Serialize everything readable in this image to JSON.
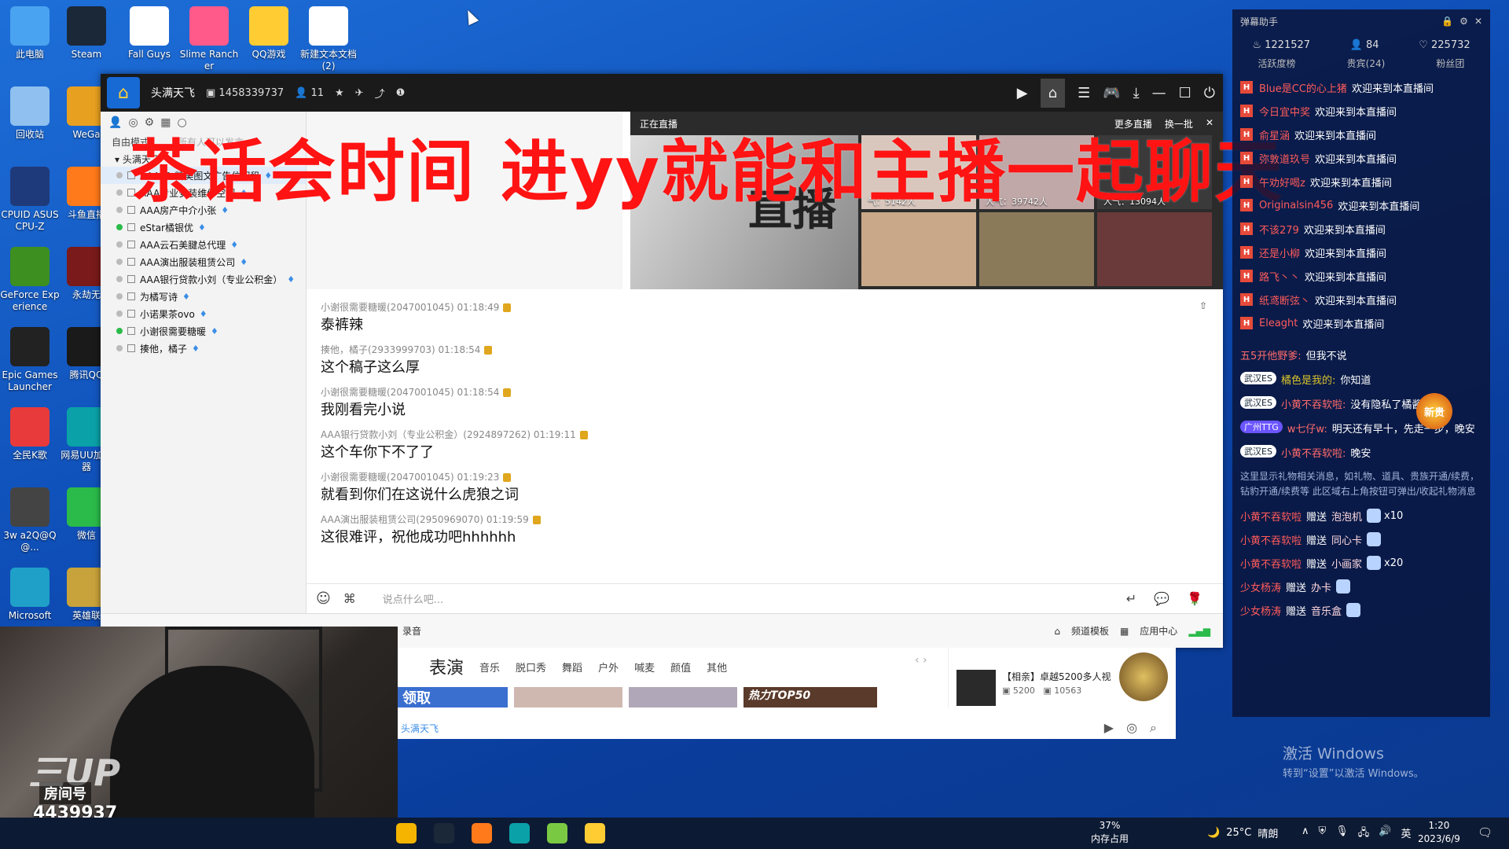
{
  "desktop": {
    "col1": [
      {
        "label": "此电脑",
        "icon": "computer-icon",
        "color": "#4aa3f0"
      },
      {
        "label": "回收站",
        "icon": "recycle-bin-icon",
        "color": "#8fc0ef"
      },
      {
        "label": "CPUID ASUS CPU-Z",
        "icon": "cpuz-icon",
        "color": "#1f3a7a"
      },
      {
        "label": "GeForce Experience",
        "icon": "geforce-icon",
        "color": "#3d8f1f"
      },
      {
        "label": "Epic Games Launcher",
        "icon": "epic-games-icon",
        "color": "#222222"
      },
      {
        "label": "全民K歌",
        "icon": "quanmin-ksong-icon",
        "color": "#e83a3a"
      },
      {
        "label": "3w a2Q@Q@...",
        "icon": "file-icon",
        "color": "#444444"
      },
      {
        "label": "Microsoft",
        "icon": "edge-icon",
        "color": "#1fa0c8"
      }
    ],
    "col2": [
      {
        "label": "Steam",
        "icon": "steam-icon",
        "color": "#1b2838"
      },
      {
        "label": "WeGa",
        "icon": "wegame-icon",
        "color": "#e8a020"
      },
      {
        "label": "斗鱼直播",
        "icon": "douyu-icon",
        "color": "#ff7a1a"
      },
      {
        "label": "永劫无",
        "icon": "naraka-icon",
        "color": "#7a1a1a"
      },
      {
        "label": "腾讯QQ",
        "icon": "qq-icon",
        "color": "#1a1a1a"
      },
      {
        "label": "网易UU加速器",
        "icon": "uu-icon",
        "color": "#0aa2a8"
      },
      {
        "label": "微信",
        "icon": "wechat-icon",
        "color": "#2bbb4a"
      },
      {
        "label": "英雄联",
        "icon": "lol-icon",
        "color": "#c8a23a"
      }
    ],
    "top": [
      {
        "label": "Fall Guys",
        "icon": "fall-guys-icon",
        "color": "#ffffff"
      },
      {
        "label": "Slime Rancher",
        "icon": "slime-rancher-icon",
        "color": "#ff5a8a"
      },
      {
        "label": "QQ游戏",
        "icon": "qq-game-icon",
        "color": "#ffcc33"
      },
      {
        "label": "新建文本文档 (2)",
        "icon": "text-doc-icon",
        "color": "#ffffff"
      }
    ]
  },
  "yy": {
    "title": "头满天飞",
    "channel_id": "1458339737",
    "online": "11",
    "overlay": "茶话会时间 进yy就能和主播一起聊天",
    "left": {
      "mode": "自由模式",
      "hint": "所有人可以发言",
      "root": "头满天飞",
      "items": [
        {
          "name": "AAA01 精美图文广告位招租",
          "on": false,
          "sel": true
        },
        {
          "name": "AAA专业安装维修空调",
          "on": false
        },
        {
          "name": "AAA房产中介小张",
          "on": false
        },
        {
          "name": "eStar橘银优",
          "on": true
        },
        {
          "name": "AAA云石美腱总代理",
          "on": false
        },
        {
          "name": "AAA演出服装租赁公司",
          "on": false
        },
        {
          "name": "AAA银行贷款小刘（专业公积金）",
          "on": false
        },
        {
          "name": "为橘写诗",
          "on": false
        },
        {
          "name": "小诺果茶ovo",
          "on": false
        },
        {
          "name": "小谢很需要糖暖",
          "on": true
        },
        {
          "name": "揍他，橘子",
          "on": false
        }
      ]
    },
    "rec": {
      "head": "正在直播",
      "more": "更多直播",
      "change": "换一批",
      "banner_text": "直播",
      "thumbs": [
        {
          "count": "气：5142人"
        },
        {
          "count": "人气：39742人"
        },
        {
          "count": "人气：13094人"
        },
        {
          "count": ""
        },
        {
          "count": ""
        },
        {
          "count": ""
        }
      ]
    },
    "messages": [
      {
        "user": "小谢很需要糖暖(2047001045)",
        "time": "01:18:49",
        "text": "泰裤辣"
      },
      {
        "user": "揍他，橘子(2933999703)",
        "time": "01:18:54",
        "text": "这个稿子这么厚"
      },
      {
        "user": "小谢很需要糖暖(2047001045)",
        "time": "01:18:54",
        "text": "我刚看完小说"
      },
      {
        "user": "AAA银行贷款小刘（专业公积金）(2924897262)",
        "time": "01:19:11",
        "text": "这个车你下不了了"
      },
      {
        "user": "小谢很需要糖暖(2047001045)",
        "time": "01:19:23",
        "text": "就看到你们在这说什么虎狼之词"
      },
      {
        "user": "AAA演出服装租赁公司(2950969070)",
        "time": "01:19:59",
        "text": "这很难评，祝他成功吧hhhhhh"
      }
    ],
    "input_placeholder": "说点什么吧...",
    "bottom": {
      "record": "录音",
      "template": "频道模板",
      "app_center": "应用中心"
    }
  },
  "sub": {
    "tabs": [
      "表演",
      "音乐",
      "脱口秀",
      "舞蹈",
      "户外",
      "喊麦",
      "颜值",
      "其他"
    ],
    "hot": "热力TOP50",
    "claim": "领取",
    "right_title": "【相亲】卓越5200多人视",
    "right_n1": "5200",
    "right_n2": "10563",
    "bottom_link": "头满天飞"
  },
  "camera": {
    "logo": "三UP",
    "room_label": "房间号",
    "room_no": "4439937"
  },
  "danmaku": {
    "title": "弹幕助手",
    "stats": [
      "1221527",
      "84",
      "225732"
    ],
    "tabs": [
      "活跃度榜",
      "贵宾(24)",
      "粉丝团"
    ],
    "welcome": [
      {
        "user": "Blue是CC的心上猪",
        "text": "欢迎来到本直播间"
      },
      {
        "user": "今日宜中奖",
        "text": "欢迎来到本直播间"
      },
      {
        "user": "俞星涵",
        "text": "欢迎来到本直播间"
      },
      {
        "user": "弥敦道玖号",
        "text": "欢迎来到本直播间"
      },
      {
        "user": "午劝好喝z",
        "text": "欢迎来到本直播间"
      },
      {
        "user": "Originalsin456",
        "text": "欢迎来到本直播间"
      },
      {
        "user": "不该279",
        "text": "欢迎来到本直播间"
      },
      {
        "user": "还是小柳",
        "text": "欢迎来到本直播间"
      },
      {
        "user": "路飞丶丶",
        "text": "欢迎来到本直播间"
      },
      {
        "user": "纸鸢断弦丶",
        "text": "欢迎来到本直播间"
      },
      {
        "user": "Eleaght",
        "text": "欢迎来到本直播间"
      }
    ],
    "chats": [
      {
        "tag": "",
        "user": "五5开他野爹:",
        "text": "但我不说"
      },
      {
        "tag": "武汉ES",
        "user": "橘色是我的:",
        "text": "你知道",
        "yellow": true
      },
      {
        "tag": "武汉ES",
        "user": "小黄不吞软啦:",
        "text": "没有隐私了橘酱"
      },
      {
        "tag": "广州TTG",
        "user": "w七仔w:",
        "text": "明天还有早十，先走一步，晚安"
      },
      {
        "tag": "武汉ES",
        "user": "小黄不吞软啦:",
        "text": "晚安"
      }
    ],
    "new_badge": "新贵",
    "sysnote": "这里显示礼物相关消息，如礼物、道具、贵族开通/续费，钻豹开通/续费等 此区域右上角按钮可弹出/收起礼物消息",
    "gifts": [
      {
        "user": "小黄不吞软啦",
        "gift": "泡泡机",
        "qty": "x10"
      },
      {
        "user": "小黄不吞软啦",
        "gift": "同心卡",
        "qty": ""
      },
      {
        "user": "小黄不吞软啦",
        "gift": "小画家",
        "qty": "x20"
      },
      {
        "user": "少女杨涛",
        "gift": "办卡",
        "qty": ""
      },
      {
        "user": "少女杨涛",
        "gift": "音乐盒",
        "qty": ""
      }
    ],
    "send_word": "赠送"
  },
  "activate": {
    "line1": "激活 Windows",
    "line2": "转到“设置”以激活 Windows。"
  },
  "taskbar": {
    "mem_pct": "37%",
    "mem_label": "内存占用",
    "temp": "25°C",
    "weather": "晴朗",
    "ime": "英",
    "time": "1:20",
    "date": "2023/6/9"
  }
}
